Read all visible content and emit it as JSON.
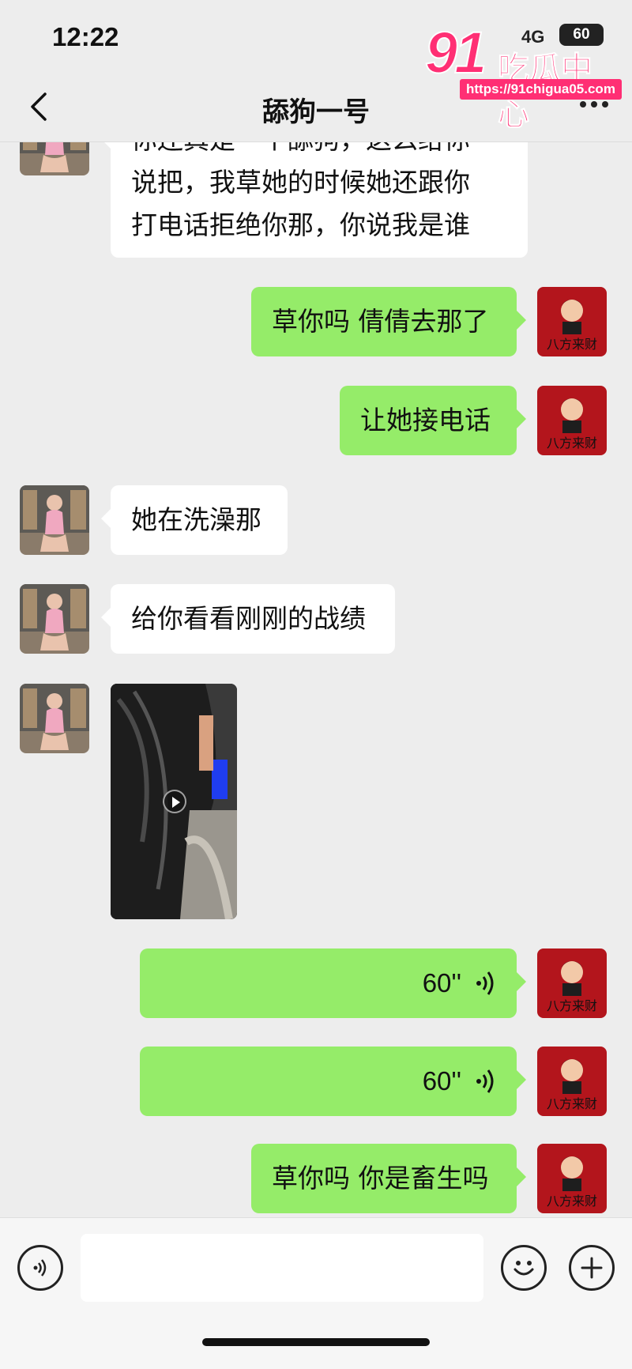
{
  "status_bar": {
    "time": "12:22",
    "signal": "4G",
    "battery": "60"
  },
  "watermark": {
    "number": "91",
    "text": "吃瓜中心",
    "url": "https://91chigua05.com"
  },
  "header": {
    "title": "舔狗一号"
  },
  "messages": [
    {
      "side": "left",
      "type": "text",
      "lines": [
        "你还真是一个舔狗，这么给你",
        "说把，我草她的时候她还跟你",
        "打电话拒绝你那，你说我是谁"
      ]
    },
    {
      "side": "right",
      "type": "text",
      "text": "草你吗 倩倩去那了"
    },
    {
      "side": "right",
      "type": "text",
      "text": "让她接电话"
    },
    {
      "side": "left",
      "type": "text",
      "text": "她在洗澡那"
    },
    {
      "side": "left",
      "type": "text",
      "text": "给你看看刚刚的战绩"
    },
    {
      "side": "left",
      "type": "video"
    },
    {
      "side": "right",
      "type": "voice",
      "duration": "60''"
    },
    {
      "side": "right",
      "type": "voice",
      "duration": "60''"
    },
    {
      "side": "right",
      "type": "text",
      "text": "草你吗 你是畜生吗"
    }
  ],
  "colors": {
    "background": "#ededed",
    "sent_bubble": "#95ec69",
    "received_bubble": "#ffffff",
    "watermark": "#ff2f74"
  },
  "icons": {
    "back": "chevron-left-icon",
    "more": "more-dots-icon",
    "voice_mode": "voice-toggle-icon",
    "emoji": "emoji-icon",
    "plus": "plus-icon",
    "voice_wave": "voice-wave-icon"
  }
}
